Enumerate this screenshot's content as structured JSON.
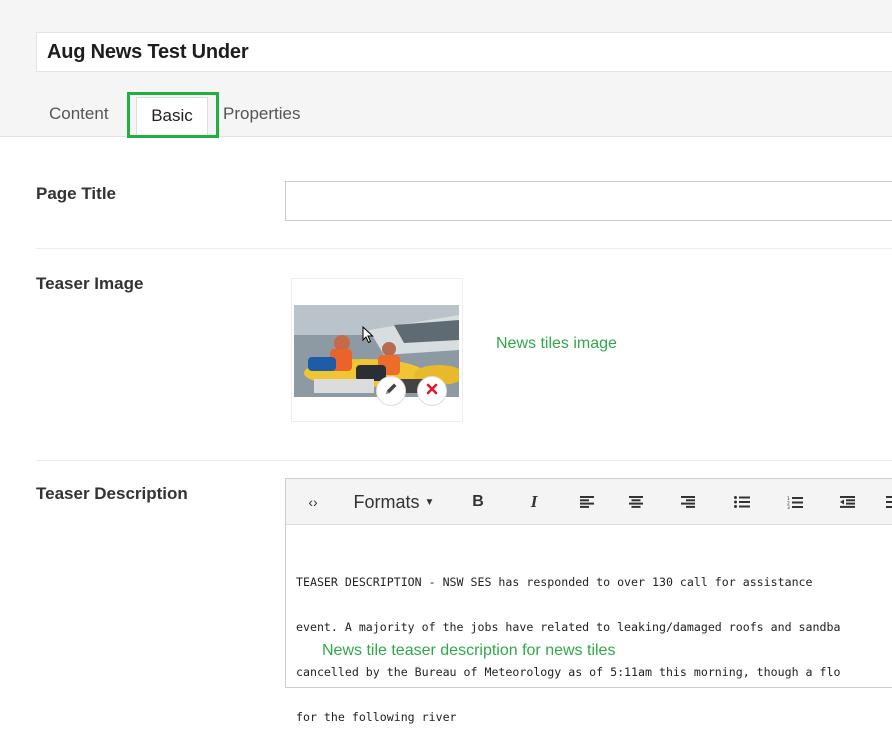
{
  "page": {
    "title_value": "Aug News Test Under",
    "tabs": [
      {
        "label": "Content",
        "active": false
      },
      {
        "label": "Basic",
        "active": true
      },
      {
        "label": "Properties",
        "active": false
      }
    ]
  },
  "fields": {
    "page_title": {
      "label": "Page Title",
      "value": ""
    },
    "teaser_image": {
      "label": "Teaser Image",
      "annotation": "News tiles image"
    },
    "teaser_description": {
      "label": "Teaser Description",
      "toolbar": {
        "source_icon": "code-icon",
        "formats_label": "Formats",
        "buttons": [
          "bold",
          "italic",
          "align-left",
          "align-center",
          "align-right",
          "bullet-list",
          "numbered-list",
          "outdent",
          "indent"
        ]
      },
      "body_lines": [
        "TEASER DESCRIPTION - NSW SES has responded to over 130 call for assistance",
        "event. A majority of the jobs have related to leaking/damaged roofs and sandba",
        "cancelled by the Bureau of Meteorology as of 5:11am this morning, though a flo",
        "for the following river"
      ],
      "annotation": "News tile teaser description for news tiles"
    }
  },
  "colors": {
    "highlight": "#1fb041",
    "annotation": "#2fa94a",
    "delete": "#e0182d"
  }
}
